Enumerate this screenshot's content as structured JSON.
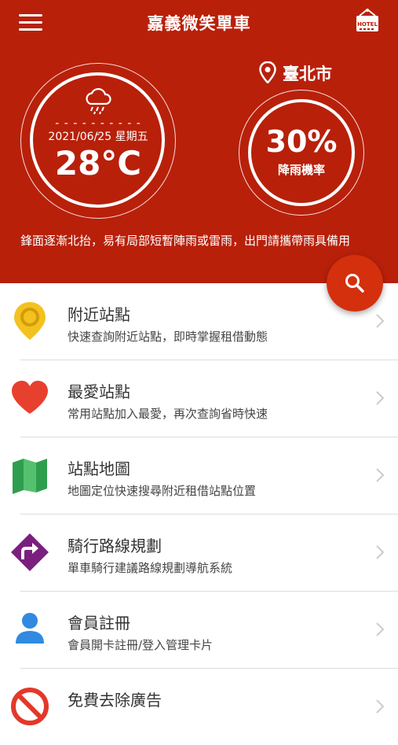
{
  "app": {
    "title": "嘉義微笑單車"
  },
  "weather": {
    "dashes": "- - - - - - - - - - -",
    "date": "2021/06/25 星期五",
    "temperature": "28°C",
    "city": "臺北市",
    "rain_chance": "30%",
    "rain_label": "降雨機率",
    "forecast": "鋒面逐漸北抬，易有局部短暫陣雨或雷雨，出門請攜帶雨具備用",
    "weather_icon": "rain-cloud-icon"
  },
  "colors": {
    "header_bg": "#b8200a",
    "fab_bg": "#d4300e"
  },
  "menu": [
    {
      "label": "附近站點",
      "desc": "快速查詢附近站點，即時掌握租借動態",
      "icon": "location-pin-icon"
    },
    {
      "label": "最愛站點",
      "desc": "常用站點加入最愛，再次查詢省時快速",
      "icon": "heart-icon"
    },
    {
      "label": "站點地圖",
      "desc": "地圖定位快速搜尋附近租借站點位置",
      "icon": "map-icon"
    },
    {
      "label": "騎行路線規劃",
      "desc": "單車騎行建議路線規劃導航系統",
      "icon": "route-icon"
    },
    {
      "label": "會員註冊",
      "desc": "會員開卡註冊/登入管理卡片",
      "icon": "user-icon"
    },
    {
      "label": "免費去除廣告",
      "desc": "",
      "icon": "no-ads-icon"
    }
  ]
}
